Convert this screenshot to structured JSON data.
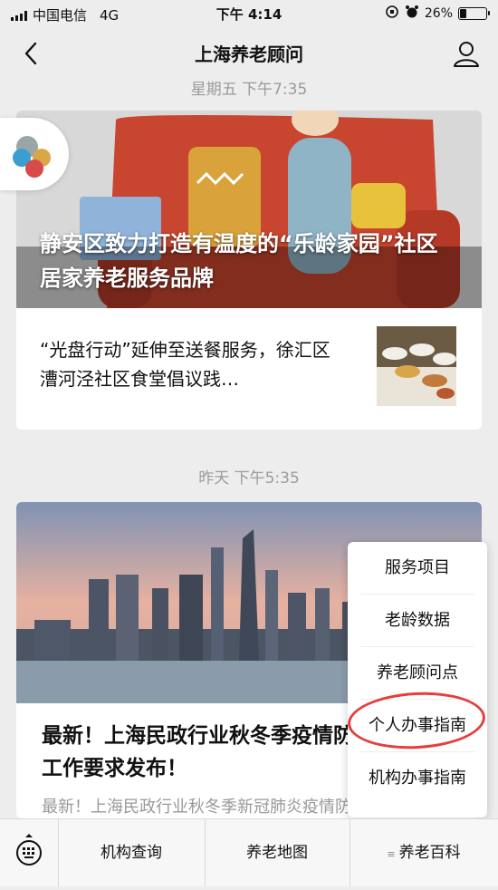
{
  "status": {
    "carrier": "中国电信",
    "network": "4G",
    "time": "下午 4:14",
    "battery": "26%",
    "battery_level": 0.26
  },
  "nav": {
    "title": "上海养老顾问"
  },
  "timestamp1": "星期五 下午7:35",
  "article1": {
    "title": "静安区致力打造有温度的“乐龄家园”社区居家养老服务品牌",
    "sub_title": "“光盘行动”延伸至送餐服务，徐汇区漕河泾社区食堂倡议践…"
  },
  "timestamp2": "昨天 下午5:35",
  "article2": {
    "title": "最新！上海民政行业秋冬季疫情防控工作要求发布！",
    "desc": "最新！上海民政行业秋冬季新冠肺炎疫情防控"
  },
  "popup_menu": [
    "服务项目",
    "老龄数据",
    "养老顾问点",
    "个人办事指南",
    "机构办事指南"
  ],
  "tabs": [
    "机构查询",
    "养老地图",
    "养老百科"
  ],
  "colors": {
    "highlight_circle": "#e53e3e"
  }
}
